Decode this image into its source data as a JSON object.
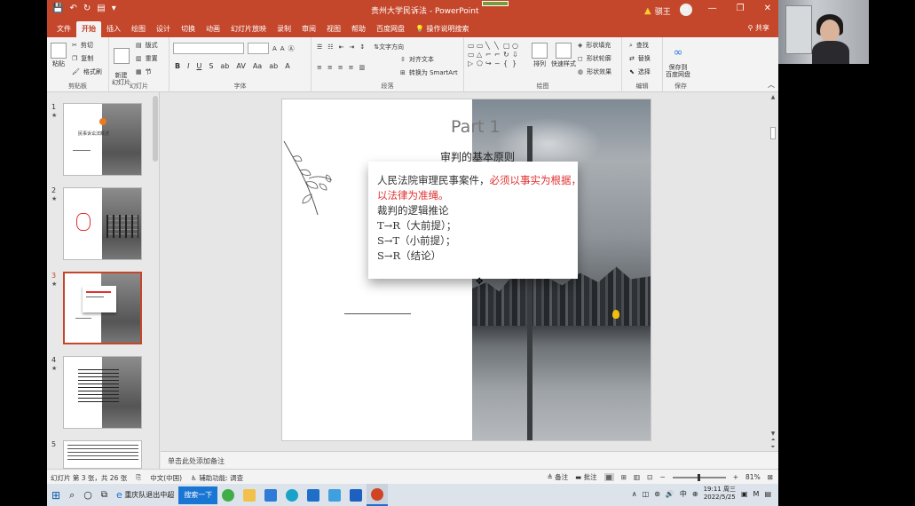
{
  "window": {
    "title": "贵州大学民诉法 - PowerPoint",
    "user": "骐王",
    "warn_icon": "warning-icon"
  },
  "tabs": [
    "文件",
    "开始",
    "插入",
    "绘图",
    "设计",
    "切换",
    "动画",
    "幻灯片放映",
    "录制",
    "审阅",
    "视图",
    "帮助",
    "百度网盘",
    "操作说明搜索"
  ],
  "active_tab": "开始",
  "share_label": "共享",
  "ribbon": {
    "clipboard": {
      "paste": "粘贴",
      "cut": "剪切",
      "copy": "复制",
      "format_painter": "格式刷",
      "label": "剪贴板"
    },
    "slides": {
      "new_slide": "新建\n幻灯片",
      "layout": "版式",
      "reset": "重置",
      "section": "节",
      "label": "幻灯片"
    },
    "font": {
      "label": "字体"
    },
    "paragraph": {
      "text_direction": "文字方向",
      "align_text": "对齐文本",
      "smartart": "转换为 SmartArt",
      "label": "段落"
    },
    "drawing": {
      "arrange": "排列",
      "quick_styles": "快速样式",
      "shape_fill": "形状填充",
      "shape_outline": "形状轮廓",
      "shape_effects": "形状效果",
      "label": "绘图"
    },
    "editing": {
      "find": "查找",
      "replace": "替换",
      "select": "选择",
      "label": "编辑"
    },
    "save": {
      "save_to_baidu": "保存到\n百度网盘",
      "label": "保存"
    }
  },
  "thumbnails": [
    {
      "num": "1",
      "star": "★",
      "title": "民事诉讼法概述"
    },
    {
      "num": "2",
      "star": "★",
      "title": ""
    },
    {
      "num": "3",
      "star": "★",
      "title": ""
    },
    {
      "num": "4",
      "star": "★",
      "title": ""
    },
    {
      "num": "5",
      "star": "",
      "title": ""
    }
  ],
  "selected_slide": 3,
  "slide": {
    "part": "Part 1",
    "heading": "审判的基本原则",
    "body_line1_a": "人民法院审理民事案件，",
    "body_line1_b": "必须以事实为根据，",
    "body_line2": "以法律为准绳。",
    "body_line3": "裁判的逻辑推论",
    "body_line4": "T→R（大前提）；",
    "body_line5": "S→T（小前提）；",
    "body_line6": "S→R（结论）"
  },
  "notes_placeholder": "单击此处添加备注",
  "status": {
    "slide_info": "幻灯片 第 3 张，共 26 张",
    "language": "中文(中国)",
    "accessibility": "辅助功能: 调查",
    "notes": "备注",
    "comments": "批注",
    "zoom": "81%"
  },
  "taskbar": {
    "search_label": "搜索一下",
    "browser_tab": "重庆队退出中超",
    "time": "19:11 周三",
    "date": "2022/5/25",
    "ime": "中"
  },
  "colors": {
    "accent": "#c4462b",
    "red_text": "#e03030"
  }
}
